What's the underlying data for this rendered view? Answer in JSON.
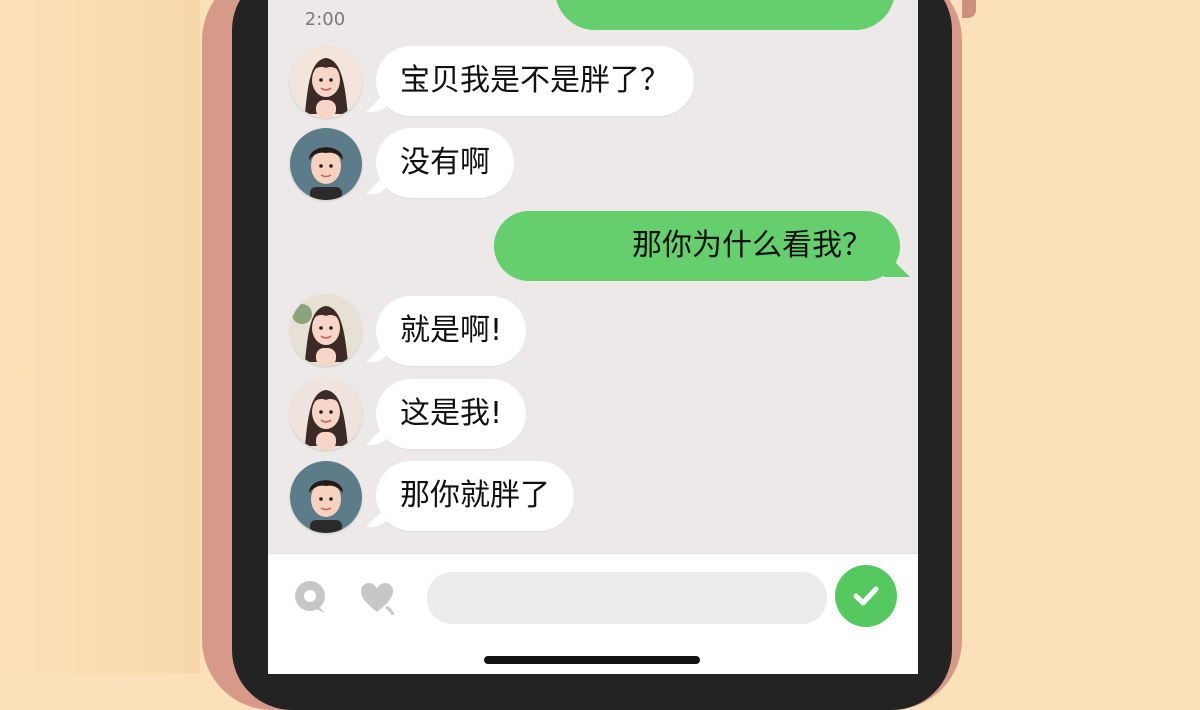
{
  "status_time": "2:00",
  "messages": [
    {
      "side": "left",
      "avatar": "woman-avatar",
      "text": "宝贝我是不是胖了？"
    },
    {
      "side": "left",
      "avatar": "man-avatar",
      "text": "没有啊"
    },
    {
      "side": "right",
      "avatar": "",
      "text": "那你为什么看我？"
    },
    {
      "side": "left",
      "avatar": "woman-avatar",
      "text": "就是啊!"
    },
    {
      "side": "left",
      "avatar": "woman-avatar",
      "text": "这是我!"
    },
    {
      "side": "left",
      "avatar": "man-avatar",
      "text": "那你就胖了"
    }
  ],
  "input": {
    "placeholder": ""
  },
  "icons": {
    "voice": "voice-icon",
    "sticker": "heart-icon",
    "send": "check-icon"
  },
  "colors": {
    "background": "#fbe1b9",
    "phone_case": "#d89a88",
    "screen": "#ece9e8",
    "incoming_bubble": "#ffffff",
    "outgoing_bubble": "#64cf6c",
    "send_button": "#55c95f"
  }
}
